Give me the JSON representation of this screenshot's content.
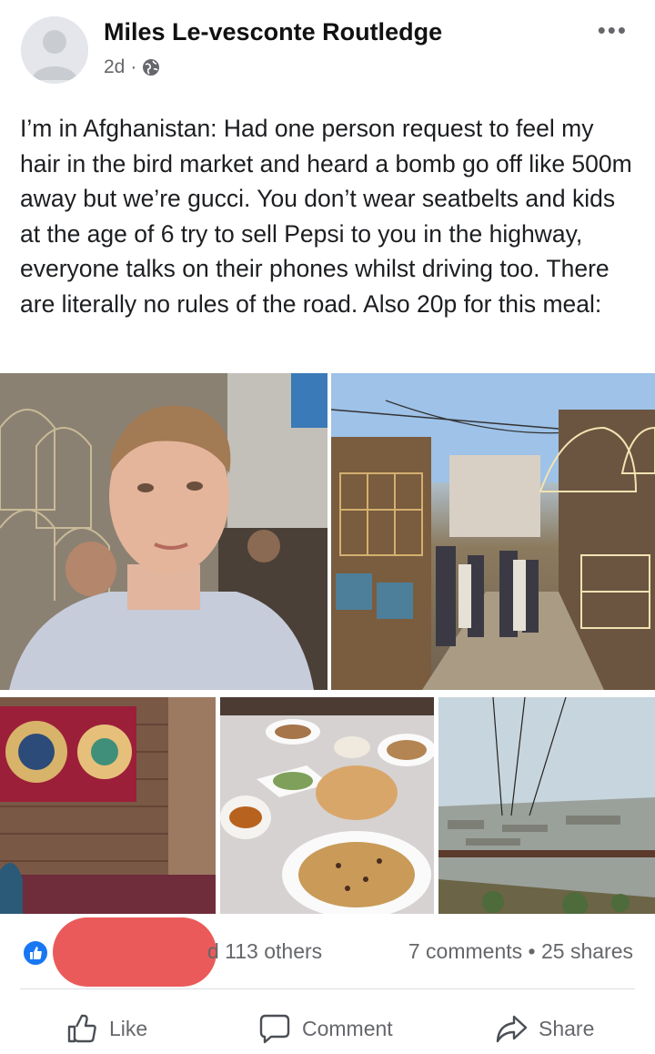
{
  "post": {
    "author": "Miles Le-vesconte Routledge",
    "time": "2d",
    "separator": "·",
    "privacy_icon": "globe-icon",
    "more_icon": "more-options-icon",
    "more_glyph": "•••",
    "text": "I’m in Afghanistan: Had one person request to feel my hair in the bird market and heard a bomb go off like 500m away but we’re gucci. You don’t wear seatbelts and kids at the age of 6 try to sell Pepsi to you in the highway, everyone talks on their phones whilst driving too. There are literally no rules of the road. Also 20p for this meal:"
  },
  "photos": [
    {
      "subject": "selfie-in-bird-market"
    },
    {
      "subject": "bird-market-street"
    },
    {
      "subject": "room-with-carpet"
    },
    {
      "subject": "meal-on-table"
    },
    {
      "subject": "city-view"
    }
  ],
  "stats": {
    "reaction_icon": "like-icon",
    "others": "d 113 others",
    "comments": "7 comments",
    "dot": "•",
    "shares": "25 shares"
  },
  "actions": {
    "like": "Like",
    "comment": "Comment",
    "share": "Share"
  },
  "colors": {
    "accent": "#1877f2",
    "redaction": "#eb5a5a",
    "secondary_text": "#65676b"
  }
}
